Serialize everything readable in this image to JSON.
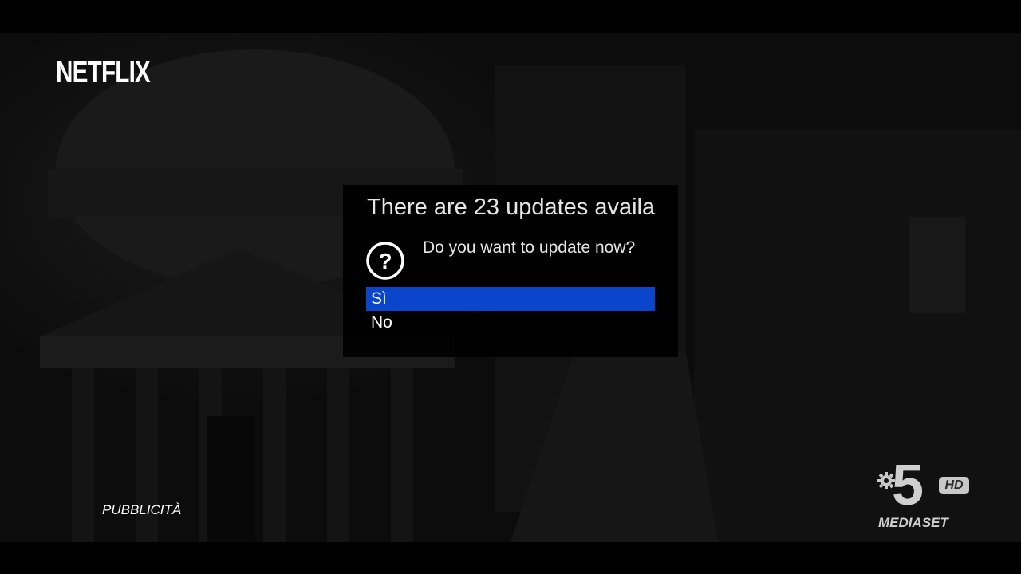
{
  "overlay": {
    "brand_logo": "NETFLIX",
    "ad_label": "PUBBLICITÀ"
  },
  "dialog": {
    "title": "There are 23 updates availa",
    "message": "Do you want to update now?",
    "icon": "question-circle-icon",
    "options": [
      {
        "label": "Sì",
        "selected": true
      },
      {
        "label": "No",
        "selected": false
      }
    ],
    "selection_color": "#0a45cc"
  },
  "channel_logo": {
    "gear_icon": "gear-icon",
    "number": "5",
    "hd_badge": "HD",
    "name": "MEDIASET"
  }
}
